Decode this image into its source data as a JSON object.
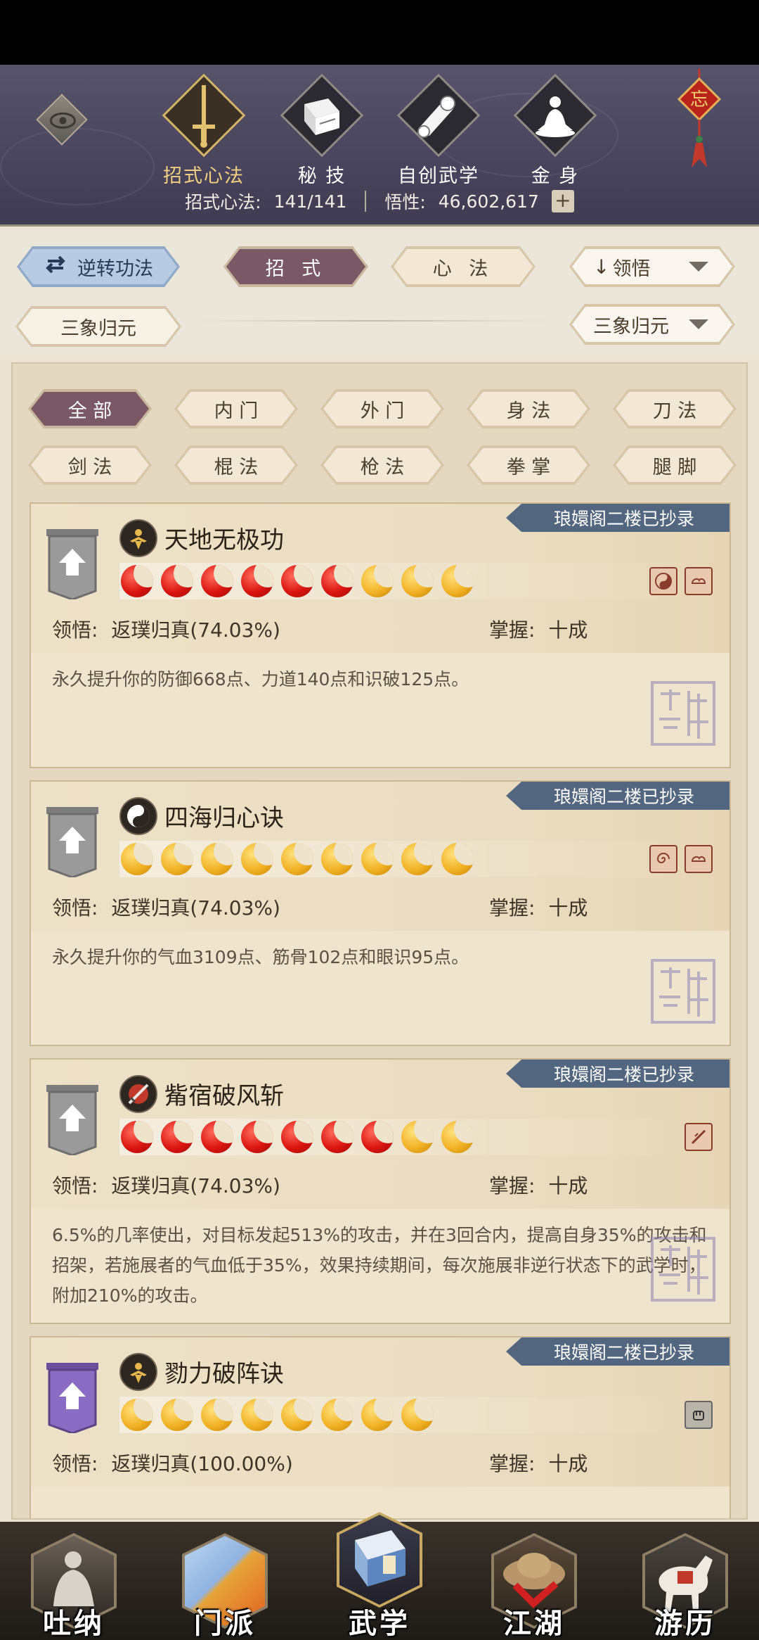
{
  "header": {
    "nav": [
      {
        "label": "招式心法",
        "icon": "sword-icon",
        "active": true
      },
      {
        "label": "秘 技",
        "icon": "book-icon",
        "active": false
      },
      {
        "label": "自创武学",
        "icon": "scroll-icon",
        "active": false
      },
      {
        "label": "金 身",
        "icon": "meditation-icon",
        "active": false
      }
    ],
    "charm_char": "忘",
    "stats": {
      "moves_label": "招式心法:",
      "moves_value": "141/141",
      "insight_label": "悟性:",
      "insight_value": "46,602,617",
      "plus": "+"
    }
  },
  "controls": {
    "reverse_label": "逆转功法",
    "tab_moves": "招 式",
    "tab_mind": "心 法",
    "sort_label": "领悟",
    "filter_left": "三象归元",
    "filter_right": "三象归元"
  },
  "categories": [
    "全 部",
    "内 门",
    "外 门",
    "身 法",
    "刀 法",
    "剑 法",
    "棍 法",
    "枪 法",
    "拳 掌",
    "腿 脚"
  ],
  "skills": [
    {
      "name": "天地无极功",
      "ribbon": "琅嬛阁二楼已抄录",
      "red": 6,
      "gold": 3,
      "comprehension_label": "领悟:",
      "comprehension": "返璞归真(74.03%)",
      "mastery_label": "掌握:",
      "mastery": "十成",
      "desc": "永久提升你的防御668点、力道140点和识破125点。",
      "seal": true
    },
    {
      "name": "四海归心诀",
      "ribbon": "琅嬛阁二楼已抄录",
      "red": 0,
      "gold": 9,
      "comprehension_label": "领悟:",
      "comprehension": "返璞归真(74.03%)",
      "mastery_label": "掌握:",
      "mastery": "十成",
      "desc": "永久提升你的气血3109点、筋骨102点和眼识95点。",
      "seal": true
    },
    {
      "name": "觜宿破风斩",
      "ribbon": "琅嬛阁二楼已抄录",
      "red": 7,
      "gold": 2,
      "comprehension_label": "领悟:",
      "comprehension": "返璞归真(74.03%)",
      "mastery_label": "掌握:",
      "mastery": "十成",
      "desc": "6.5%的几率使出，对目标发起513%的攻击，并在3回合内，提高自身35%的攻击和招架，若施展者的气血低于35%，效果持续期间，每次施展非逆行状态下的武学时，附加210%的攻击。",
      "seal": true
    },
    {
      "name": "勠力破阵诀",
      "ribbon": "琅嬛阁二楼已抄录",
      "red": 0,
      "gold": 8,
      "comprehension_label": "领悟:",
      "comprehension": "返璞归真(100.00%)",
      "mastery_label": "掌握:",
      "mastery": "十成",
      "desc": "",
      "seal": false
    }
  ],
  "bottom_nav": [
    {
      "label": "吐纳",
      "active": false
    },
    {
      "label": "门派",
      "active": false
    },
    {
      "label": "武学",
      "active": true
    },
    {
      "label": "江湖",
      "active": false
    },
    {
      "label": "游历",
      "active": false
    }
  ],
  "colors": {
    "header_bg": "#4a4660",
    "ribbon": "#52677f",
    "active_gold": "#f3cf7f",
    "bead_red": "#d9140f",
    "bead_gold": "#f0b124"
  }
}
